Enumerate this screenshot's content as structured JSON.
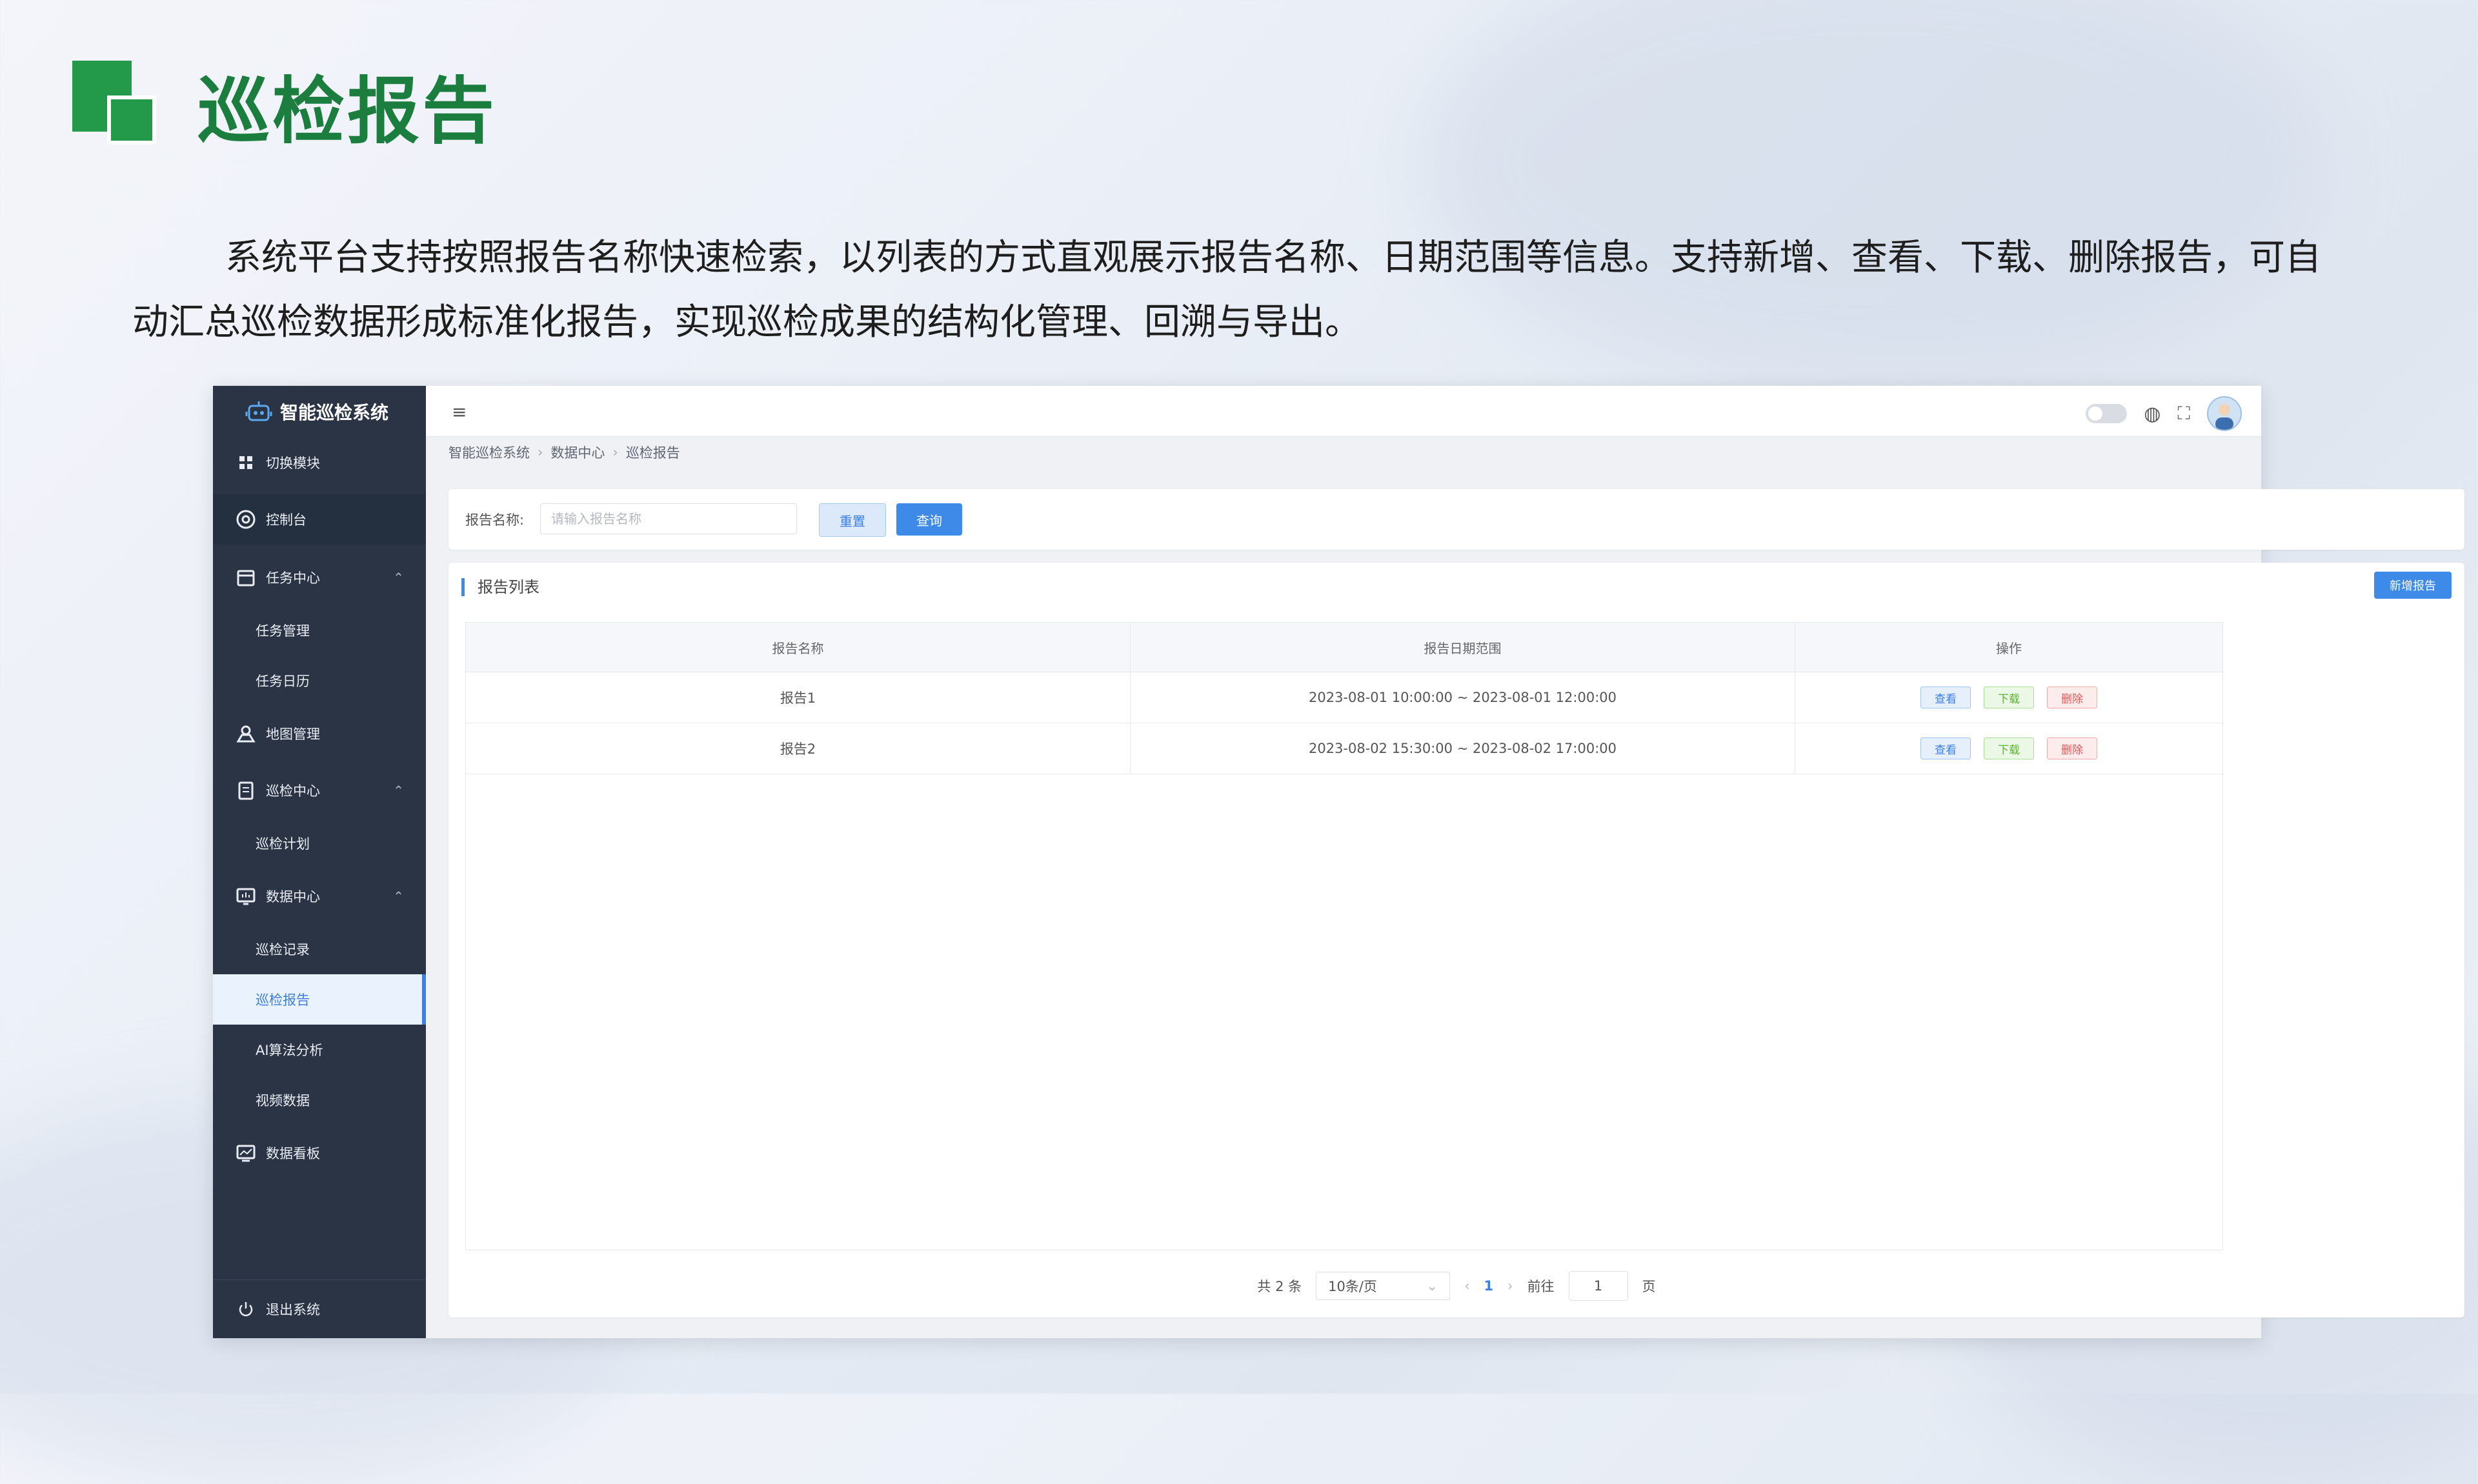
{
  "slide": {
    "title": "巡检报告",
    "intro": "系统平台支持按照报告名称快速检索，以列表的方式直观展示报告名称、日期范围等信息。支持新增、查看、下载、删除报告，可自动汇总巡检数据形成标准化报告，实现巡检成果的结构化管理、回溯与导出。"
  },
  "app": {
    "name": "智能巡检系统",
    "menu": {
      "switch_module": "切换模块",
      "console": "控制台",
      "task_center": "任务中心",
      "task_manage": "任务管理",
      "task_calendar": "任务日历",
      "map_manage": "地图管理",
      "patrol_center": "巡检中心",
      "patrol_plan": "巡检计划",
      "data_center": "数据中心",
      "patrol_record": "巡检记录",
      "patrol_report": "巡检报告",
      "ai_analysis": "AI算法分析",
      "video_data": "视频数据",
      "data_board": "数据看板",
      "logout": "退出系统"
    },
    "breadcrumb": [
      "智能巡检系统",
      "数据中心",
      "巡检报告"
    ]
  },
  "search": {
    "label": "报告名称:",
    "placeholder": "请输入报告名称",
    "reset": "重置",
    "query": "查询"
  },
  "list": {
    "title": "报告列表",
    "add": "新增报告",
    "headers": [
      "报告名称",
      "报告日期范围",
      "操作"
    ],
    "rows": [
      {
        "name": "报告1",
        "range": "2023-08-01 10:00:00 ~ 2023-08-01 12:00:00"
      },
      {
        "name": "报告2",
        "range": "2023-08-02 15:30:00 ~ 2023-08-02 17:00:00"
      }
    ],
    "actions": {
      "view": "查看",
      "download": "下载",
      "delete": "删除"
    }
  },
  "pagination": {
    "total": "共 2 条",
    "page_size": "10条/页",
    "current": "1",
    "goto_label": "前往",
    "goto_value": "1",
    "page_suffix": "页"
  },
  "colors": {
    "brand_green": "#239a4a",
    "sidebar": "#2a3445",
    "primary": "#3d8ae8"
  }
}
